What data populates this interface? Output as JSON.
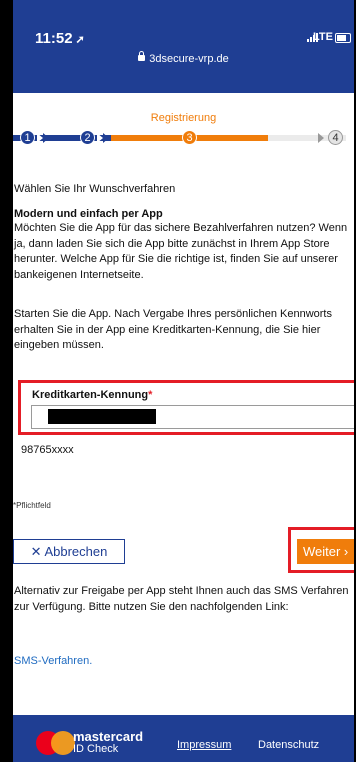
{
  "statusbar": {
    "time": "11:52",
    "network": "LTE",
    "url": "3dsecure-vrp.de"
  },
  "header": {
    "step_title": "Registrierung"
  },
  "steps": [
    "1",
    "2",
    "3",
    "4"
  ],
  "current_step": 3,
  "content": {
    "heading": "Wählen Sie Ihr Wunschverfahren",
    "subheading": "Modern und einfach per App",
    "paragraph1": "Möchten Sie die App für das sichere Bezahlverfahren nutzen? Wenn ja, dann laden Sie sich die App bitte zunächst in Ihrem App Store herunter. Welche App für Sie die richtige ist, finden Sie auf unserer bankeigenen Internetseite.",
    "paragraph2": "Starten Sie die App. Nach Vergabe Ihres persönlichen Kennworts erhalten Sie in der App eine Kreditkarten-Kennung, die Sie hier eingeben müssen."
  },
  "form": {
    "field_label": "Kreditkarten-Kennung",
    "required_marker": "*",
    "field_hint": "98765xxxx",
    "required_note": "*Pflichtfeld"
  },
  "buttons": {
    "cancel": "✕ Abbrechen",
    "next": "Weiter ›"
  },
  "alt": {
    "text": "Alternativ zur Freigabe per App steht Ihnen auch das SMS Verfahren zur Verfügung. Bitte nutzen Sie den nachfolgenden Link:",
    "link": "SMS-Verfahren."
  },
  "footer": {
    "brand": "mastercard",
    "brand_sub": "ID Check",
    "impressum": "Impressum",
    "datenschutz": "Datenschutz"
  },
  "colors": {
    "primary": "#1f3e93",
    "accent": "#f07d0b",
    "highlight": "#e41d26",
    "link": "#1f6bc1"
  }
}
